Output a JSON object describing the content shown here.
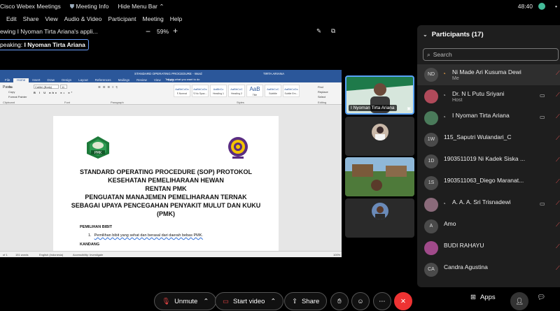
{
  "topbar": {
    "app_title": "Cisco Webex Meetings",
    "meeting_info": "Meeting Info",
    "hide_menu": "Hide Menu Bar",
    "time": "48:40"
  },
  "menubar": [
    "Edit",
    "Share",
    "View",
    "Audio & Video",
    "Participant",
    "Meeting",
    "Help"
  ],
  "viewing": {
    "label": "ewing I Nyoman Tirta Ariana's appli...",
    "minus": "−",
    "zoom": "59%",
    "plus": "+"
  },
  "speaking": {
    "prefix": "peaking:",
    "name": "I Nyoman Tirta Ariana"
  },
  "word": {
    "title": "STANDARD OPERATING PROCEDURE  -  Word",
    "user": "TIRTA ARIANA",
    "tabs": [
      "File",
      "Home",
      "Insert",
      "Draw",
      "Design",
      "Layout",
      "References",
      "Mailings",
      "Review",
      "View",
      "Help"
    ],
    "tell_me": "Tell me what you want to do",
    "font_name": "Calibri (Body)",
    "font_size": "11",
    "clipboard": {
      "paste": "Paste",
      "cut": "Cut",
      "copy": "Copy",
      "format": "Format Painter",
      "label": "Clipboard"
    },
    "group_labels": {
      "font": "Font",
      "paragraph": "Paragraph",
      "styles": "Styles",
      "editing": "Editing"
    },
    "styles": [
      {
        "sample": "AaBbCcDc",
        "name": "¶ Normal"
      },
      {
        "sample": "AaBbCcDc",
        "name": "¶ No Spac..."
      },
      {
        "sample": "AaBbCc",
        "name": "Heading 1"
      },
      {
        "sample": "AaBbCcC",
        "name": "Heading 2"
      },
      {
        "sample": "AaB",
        "name": "Title"
      },
      {
        "sample": "AaBbCcC",
        "name": "Subtitle"
      },
      {
        "sample": "AaBbCcDc",
        "name": "Subtle Em..."
      }
    ],
    "editing": {
      "find": "Find",
      "replace": "Replace",
      "select": "Select"
    },
    "doc_title_lines": [
      "STANDARD OPERATING PROCEDURE (SOP) PROTOKOL",
      "KESEHATAN PEMELIHARAAN HEWAN",
      "RENTAN PMK",
      "PENGUATAN MANAJEMEN PEMELIHARAAN TERNAK",
      "SEBAGAI UPAYA PENCEGAHAN PENYAKIT MULUT DAN KUKU",
      "(PMK)"
    ],
    "section1": "PEMILIHAN BIBIT",
    "item1_num": "1.",
    "item1_text": "Pemilihan bibit yang sehat dan berasal dari daerah bebas PMK.",
    "section2": "KANDANG",
    "logo_left_text": "PMK",
    "status": {
      "page": "of 1",
      "words": "151 words",
      "lang": "English (Indonesia)",
      "access": "Accessibility: Investigate",
      "zoom": "100%"
    }
  },
  "tiles": [
    {
      "name": "I Nyoman Tirta Ariana",
      "active": true
    },
    {
      "name": ""
    },
    {
      "name": ""
    },
    {
      "name": ""
    }
  ],
  "participants": {
    "title": "Participants (17)",
    "search_placeholder": "Search",
    "list": [
      {
        "initials": "ND",
        "name": "Ni Made Ari Kusuma Dewi",
        "sub": "Me"
      },
      {
        "initials": "",
        "name": "Dr. N L Putu Sriyani",
        "sub": "Host"
      },
      {
        "initials": "",
        "name": "I Nyoman Tirta Ariana",
        "sub": ""
      },
      {
        "initials": "1W",
        "name": "115_Saputri Wulandari_C",
        "sub": ""
      },
      {
        "initials": "1D",
        "name": "1903511019 Ni Kadek Siska ...",
        "sub": ""
      },
      {
        "initials": "1S",
        "name": "1903511063_Diego Maranat...",
        "sub": ""
      },
      {
        "initials": "",
        "name": "A. A. A. Sri Trisnadewi",
        "sub": ""
      },
      {
        "initials": "A",
        "name": "Amo",
        "sub": ""
      },
      {
        "initials": "",
        "name": "BUDI RAHAYU",
        "sub": ""
      },
      {
        "initials": "CA",
        "name": "Candra Agustina",
        "sub": ""
      }
    ]
  },
  "controls": {
    "unmute": "Unmute",
    "start_video": "Start video",
    "share": "Share",
    "apps": "Apps"
  },
  "colors": {
    "word_blue": "#2b579a",
    "active_border": "#58a2f8",
    "end_red": "#e33333",
    "mute_red": "#e84545"
  }
}
